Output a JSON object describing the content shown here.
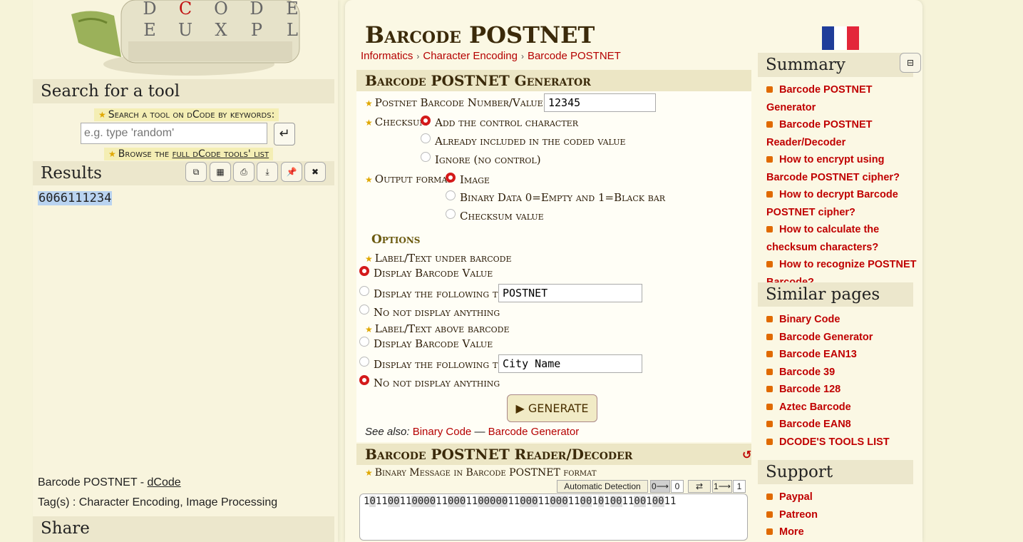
{
  "left": {
    "search_title": "Search for a tool",
    "search_label": "Search a tool on dCode by keywords:",
    "search_placeholder": "e.g. type 'random'",
    "browse_prefix": "Browse the ",
    "browse_link": "full dCode tools' list",
    "results_title": "Results",
    "result_value": "6066111234",
    "footer_title": "Barcode POSTNET - ",
    "footer_link": "dCode",
    "tags": "Tag(s) : Character Encoding, Image Processing",
    "share_title": "Share",
    "logo_letters": [
      "D",
      "C",
      "O",
      "D",
      "E",
      "E",
      "U",
      "X",
      "P",
      "L"
    ]
  },
  "main": {
    "title": "Barcode POSTNET",
    "breadcrumb": [
      "Informatics",
      "Character Encoding",
      "Barcode POSTNET"
    ],
    "generator_title": "Barcode POSTNET Generator",
    "number_label": "Postnet Barcode Number/Value",
    "number_value": "12345",
    "checksum_label": "Checksum",
    "checksum_opt1": "Add the control character",
    "checksum_opt2": "Already included in the coded value",
    "checksum_opt3": "Ignore (no control)",
    "output_label": "Output format",
    "output_opt1": "Image",
    "output_opt2": "Binary Data 0=Empty and 1=Black bar",
    "output_opt3": "Checksum value",
    "options_title": "Options",
    "under_label": "Label/Text under barcode",
    "under_opt1": "Display Barcode Value",
    "under_opt2": "Display the following text",
    "under_text": "POSTNET",
    "under_opt3": "No not display anything",
    "above_label": "Label/Text above barcode",
    "above_opt1": "Display Barcode Value",
    "above_opt2": "Display the following text",
    "above_text": "City Name",
    "above_opt3": "No not display anything",
    "generate": "▶ GENERATE",
    "see_also_label": "See also:",
    "see_also": [
      "Binary Code",
      "Barcode Generator"
    ],
    "see_also_sep": "—",
    "reader_title": "Barcode POSTNET Reader/Decoder",
    "binary_label": "Binary Message in Barcode POSTNET format",
    "auto_detect": "Automatic Detection",
    "zero_arrow": "0⟶",
    "zero_val": "0",
    "swap": "⇄",
    "one_arrow": "1⟶",
    "one_val": "1",
    "binary_value_parts": [
      "1",
      "0",
      "11",
      "00",
      "11",
      "0000",
      "11",
      "000",
      "11",
      "00000",
      "11",
      "000",
      "11",
      "000",
      "11",
      "00",
      "1",
      "0",
      "1",
      "00",
      "11",
      "00",
      "1",
      "00",
      "11"
    ]
  },
  "side": {
    "summary_title": "Summary",
    "summary_items": [
      "Barcode POSTNET Generator",
      "Barcode POSTNET Reader/Decoder",
      "How to encrypt using Barcode POSTNET cipher?",
      "How to decrypt Barcode POSTNET cipher?",
      "How to calculate the checksum characters?",
      "How to recognize POSTNET Barcode?"
    ],
    "similar_title": "Similar pages",
    "similar_items": [
      "Binary Code",
      "Barcode Generator",
      "Barcode EAN13",
      "Barcode 39",
      "Barcode 128",
      "Aztec Barcode",
      "Barcode EAN8",
      "DCODE'S TOOLS LIST"
    ],
    "support_title": "Support",
    "support_items": [
      "Paypal",
      "Patreon",
      "More"
    ]
  },
  "colors": {
    "accent_red": "#c00000",
    "radio_red": "#d41a1a",
    "flag_blue": "#1f3d9a",
    "flag_red": "#e3263a"
  }
}
